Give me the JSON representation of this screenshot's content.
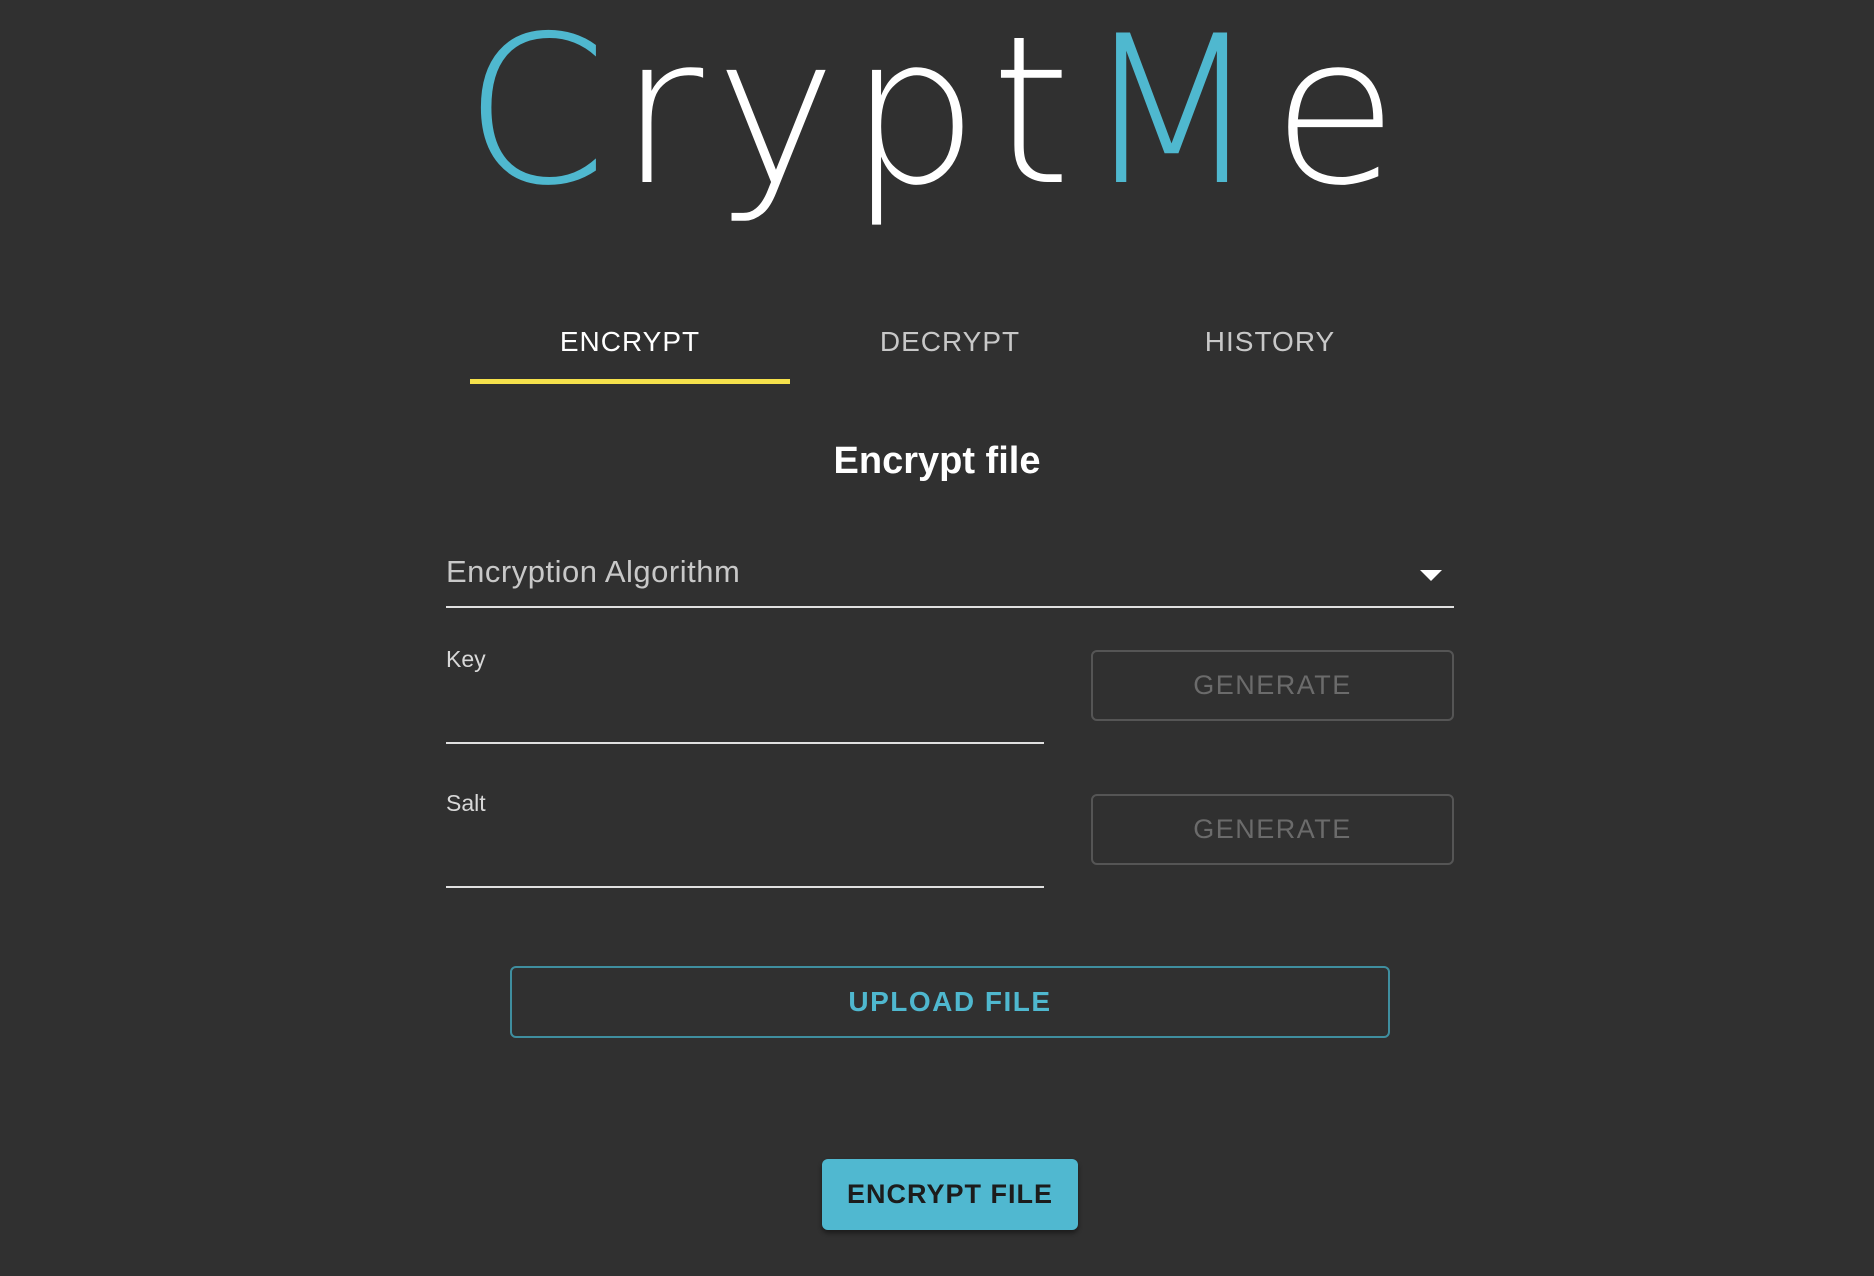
{
  "app": {
    "logo_parts": [
      "C",
      "rypt",
      "M",
      "e"
    ]
  },
  "tabs": [
    {
      "label": "ENCRYPT",
      "active": true
    },
    {
      "label": "DECRYPT",
      "active": false
    },
    {
      "label": "HISTORY",
      "active": false
    }
  ],
  "main": {
    "section_title": "Encrypt file",
    "algorithm_select": {
      "label": "Encryption Algorithm",
      "icon": "dropdown-arrow-icon"
    },
    "key_field": {
      "label": "Key",
      "value": ""
    },
    "salt_field": {
      "label": "Salt",
      "value": ""
    },
    "generate_key_label": "GENERATE",
    "generate_salt_label": "GENERATE",
    "upload_label": "UPLOAD FILE",
    "submit_label": "ENCRYPT FILE"
  },
  "colors": {
    "background": "#303030",
    "accent": "#4fb8cf",
    "tab_indicator": "#f5e14b",
    "text": "#ffffff",
    "disabled_text": "#6b6b6b"
  }
}
